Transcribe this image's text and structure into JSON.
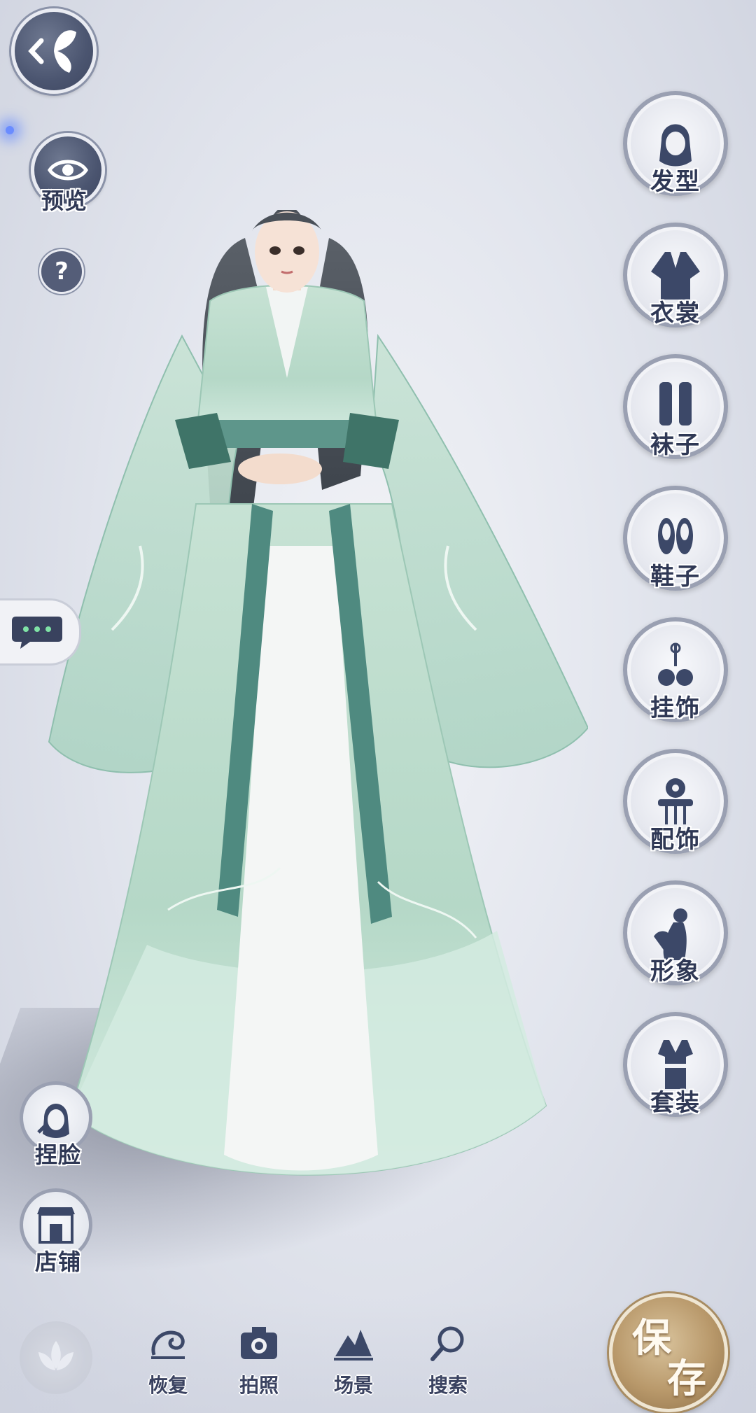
{
  "top_left": {
    "preview_label": "预览",
    "help_symbol": "?"
  },
  "right_menu": [
    {
      "label": "发型",
      "icon": "hairstyle-icon"
    },
    {
      "label": "衣裳",
      "icon": "clothing-icon"
    },
    {
      "label": "袜子",
      "icon": "socks-icon"
    },
    {
      "label": "鞋子",
      "icon": "shoes-icon"
    },
    {
      "label": "挂饰",
      "icon": "pendant-icon"
    },
    {
      "label": "配饰",
      "icon": "accessory-icon"
    },
    {
      "label": "形象",
      "icon": "appearance-icon"
    },
    {
      "label": "套装",
      "icon": "outfit-set-icon"
    }
  ],
  "left_tools": {
    "face_label": "捏脸",
    "shop_label": "店铺"
  },
  "bottom_bar": [
    {
      "label": "恢复",
      "icon": "restore-icon"
    },
    {
      "label": "拍照",
      "icon": "camera-icon"
    },
    {
      "label": "场景",
      "icon": "scene-icon"
    },
    {
      "label": "搜索",
      "icon": "search-icon"
    }
  ],
  "save": {
    "char1": "保",
    "char2": "存"
  },
  "colors": {
    "icon_dark": "#2f3855",
    "save_gold": "#b8986a",
    "robe_green": "#b9d8c8",
    "robe_teal": "#4f8a80"
  }
}
